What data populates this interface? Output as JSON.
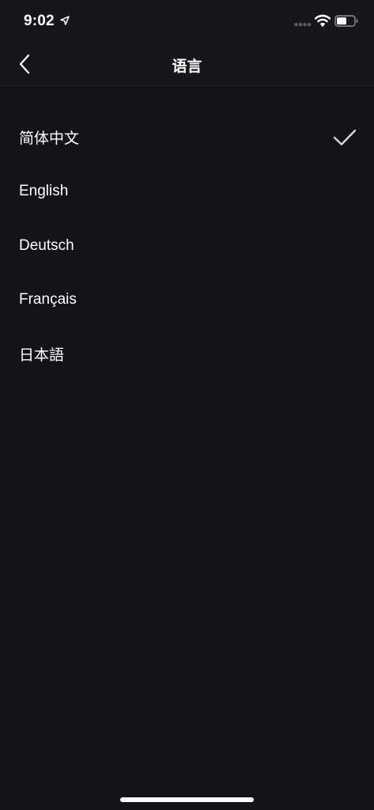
{
  "status_bar": {
    "time": "9:02",
    "icons": [
      "location-arrow-icon",
      "cellular-signal-icon",
      "wifi-icon",
      "battery-icon"
    ]
  },
  "nav": {
    "title": "语言",
    "back_icon": "chevron-left-icon"
  },
  "languages": {
    "items": [
      {
        "label": "简体中文",
        "selected": true
      },
      {
        "label": "English",
        "selected": false
      },
      {
        "label": "Deutsch",
        "selected": false
      },
      {
        "label": "Français",
        "selected": false
      },
      {
        "label": "日本語",
        "selected": false
      }
    ],
    "selected_icon": "checkmark-icon"
  },
  "colors": {
    "background": "#141319",
    "bar_background": "#17171b",
    "text": "#ffffff",
    "check": "#d9d9dc"
  }
}
